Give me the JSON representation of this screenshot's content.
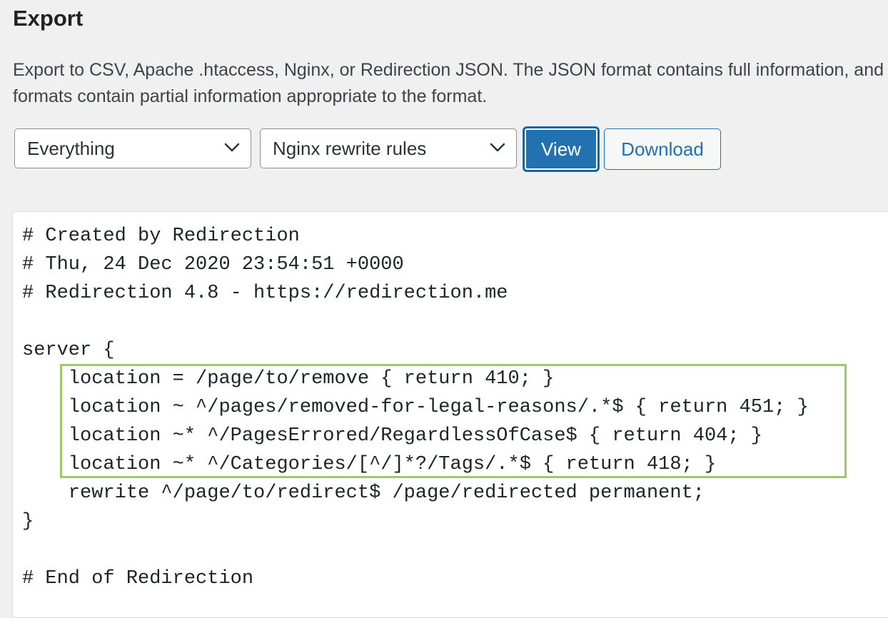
{
  "header": {
    "title": "Export"
  },
  "description": {
    "text": "Export to CSV, Apache .htaccess, Nginx, or Redirection JSON. The JSON format contains full information, and other formats contain partial information appropriate to the format."
  },
  "controls": {
    "scope_select": {
      "selected": "Everything"
    },
    "format_select": {
      "selected": "Nginx rewrite rules"
    },
    "view_label": "View",
    "download_label": "Download"
  },
  "colors": {
    "primary": "#2271b1",
    "highlight_border": "#9cc96b",
    "background": "#f0f0f1"
  },
  "icons": {
    "dropdown": "chevron-down-icon"
  },
  "export_output": {
    "lines": [
      "# Created by Redirection",
      "# Thu, 24 Dec 2020 23:54:51 +0000",
      "# Redirection 4.8 - https://redirection.me",
      "",
      "server {",
      "    location = /page/to/remove { return 410; }",
      "    location ~ ^/pages/removed-for-legal-reasons/.*$ { return 451; }",
      "    location ~* ^/PagesErrored/RegardlessOfCase$ { return 404; }",
      "    location ~* ^/Categories/[^/]*?/Tags/.*$ { return 418; }",
      "    rewrite ^/page/to/redirect$ /page/redirected permanent;",
      "}",
      "",
      "# End of Redirection"
    ]
  }
}
